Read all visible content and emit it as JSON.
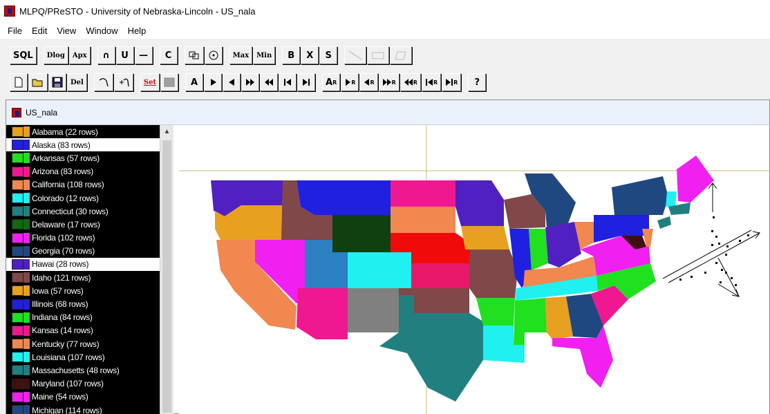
{
  "window": {
    "title": "MLPQ/PReSTO - University of Nebraska-Lincoln - US_nala"
  },
  "menu": [
    "File",
    "Edit",
    "View",
    "Window",
    "Help"
  ],
  "toolbar1": {
    "sql": "SQL",
    "dlog": "Dlog",
    "apx": "Apx",
    "intersect": "∩",
    "union": "U",
    "difference": "—",
    "complement": "C",
    "max": "Max",
    "min": "Min",
    "b": "B",
    "x": "X",
    "s": "S"
  },
  "toolbar2": {
    "del": "Del",
    "set": "Set",
    "a": "A",
    "ar": "A",
    "sub_r": "R",
    "help": "?"
  },
  "document": {
    "title": "US_nala",
    "layers": [
      {
        "label": "Alabama (22 rows)",
        "color": "#e8a020"
      },
      {
        "label": "Alaska (83 rows)",
        "color": "#2020e0",
        "selected": true
      },
      {
        "label": "Arkansas (57 rows)",
        "color": "#20e020"
      },
      {
        "label": "Arizona (83 rows)",
        "color": "#f01890"
      },
      {
        "label": "California (108 rows)",
        "color": "#f08850"
      },
      {
        "label": "Colorado (12 rows)",
        "color": "#20f0f0"
      },
      {
        "label": "Connecticut (30 rows)",
        "color": "#208080"
      },
      {
        "label": "Delaware (17 rows)",
        "color": "#106810"
      },
      {
        "label": "Florida (102 rows)",
        "color": "#f020f0"
      },
      {
        "label": "Georgia (70 rows)",
        "color": "#204880"
      },
      {
        "label": "Hawai (28 rows)",
        "color": "#5020c0",
        "selected": true
      },
      {
        "label": "Idaho (121 rows)",
        "color": "#804848"
      },
      {
        "label": "Iowa (57 rows)",
        "color": "#e8a020"
      },
      {
        "label": "Illinois (68 rows)",
        "color": "#2020e0"
      },
      {
        "label": "Indiana (84 rows)",
        "color": "#20e020"
      },
      {
        "label": "Kansas (14 rows)",
        "color": "#f01890"
      },
      {
        "label": "Kentucky (77 rows)",
        "color": "#f08850"
      },
      {
        "label": "Louisiana (107 rows)",
        "color": "#20f0f0"
      },
      {
        "label": "Massachusetts (48 rows)",
        "color": "#208080"
      },
      {
        "label": "Maryland (107 rows)",
        "color": "#401010"
      },
      {
        "label": "Maine (54 rows)",
        "color": "#f020f0"
      },
      {
        "label": "Michigan (114 rows)",
        "color": "#204880"
      }
    ]
  },
  "colors": {
    "guide_line": "#c8b870",
    "selection_background": "#ffffff",
    "list_background": "#000000"
  }
}
